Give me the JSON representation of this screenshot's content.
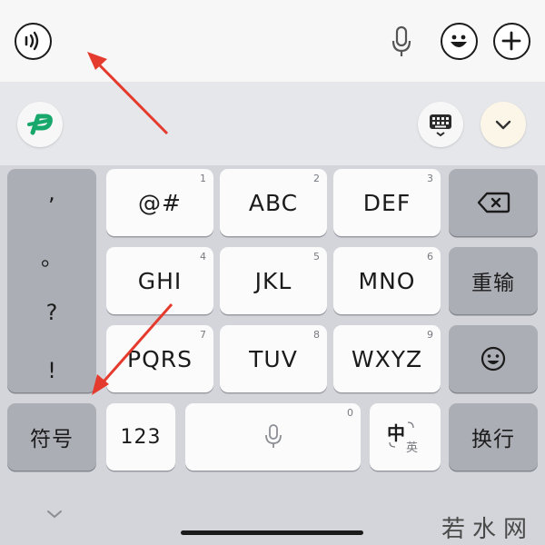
{
  "top": {
    "icons": [
      "sound-wave-icon",
      "microphone-icon",
      "emoji-icon",
      "plus-icon"
    ]
  },
  "toolbar": {
    "logo_icon": "brand-logo-icon",
    "keyboard_icon": "keyboard-switch-icon",
    "collapse_icon": "chevron-down-icon"
  },
  "keys": {
    "symbols": [
      ",",
      "。",
      "?",
      "!"
    ],
    "row1": [
      {
        "label": "@#",
        "num": "1"
      },
      {
        "label": "ABC",
        "num": "2"
      },
      {
        "label": "DEF",
        "num": "3"
      }
    ],
    "row2": [
      {
        "label": "GHI",
        "num": "4"
      },
      {
        "label": "JKL",
        "num": "5"
      },
      {
        "label": "MNO",
        "num": "6"
      }
    ],
    "row3": [
      {
        "label": "PQRS",
        "num": "7"
      },
      {
        "label": "TUV",
        "num": "8"
      },
      {
        "label": "WXYZ",
        "num": "9"
      }
    ],
    "reenter": "重输",
    "symbol_key": "符号",
    "num_key": "123",
    "space_num": "0",
    "lang_main": "中",
    "lang_alt": "英",
    "enter": "换行"
  },
  "watermark": "若水网",
  "colors": {
    "arrow": "#e53b2e",
    "logo": "#19a86c"
  }
}
